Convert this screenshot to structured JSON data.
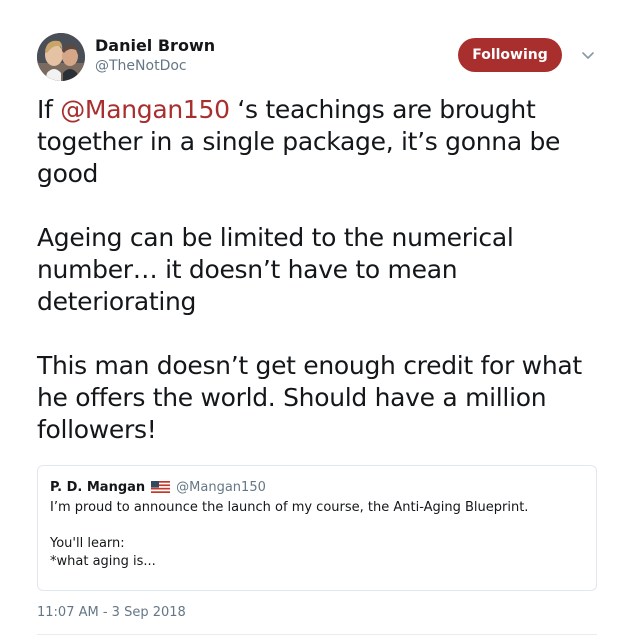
{
  "author": {
    "name": "Daniel Brown",
    "handle": "@TheNotDoc"
  },
  "follow_button": {
    "label": "Following",
    "color": "#a92f2f"
  },
  "menu_icon": "chevron-down-icon",
  "tweet": {
    "p1_before": "If ",
    "p1_mention": "@Mangan150",
    "p1_after": " ‘s teachings are brought together in a single package, it’s gonna be good",
    "p2": "Ageing can be limited to the numerical number… it doesn’t have to mean deteriorating",
    "p3": "This man doesn’t get enough credit for what he offers the world. Should have a million followers!"
  },
  "quoted_tweet": {
    "name": "P. D. Mangan",
    "flag_icon": "us-flag-icon",
    "handle": "@Mangan150",
    "line1": "I’m proud to announce the launch of my course, the Anti-Aging Blueprint.",
    "line2": "You'll learn:",
    "line3": "*what aging is..."
  },
  "timestamp": "11:07 AM - 3 Sep 2018"
}
